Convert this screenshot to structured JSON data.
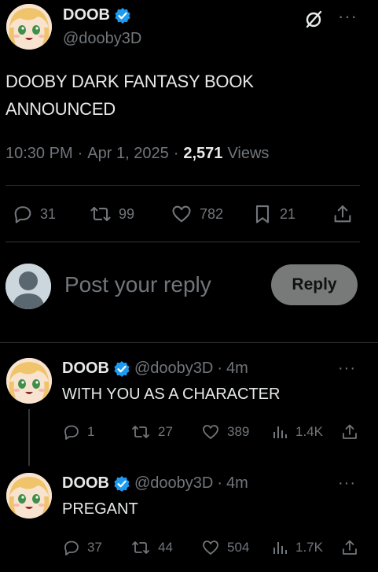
{
  "main_tweet": {
    "author": {
      "name": "DOOB",
      "handle": "@dooby3D",
      "verified": true
    },
    "text_line1": "DOOBY DARK FANTASY BOOK",
    "text_line2": "ANNOUNCED",
    "time": "10:30 PM",
    "sep1": "·",
    "date": "Apr 1, 2025",
    "sep2": "·",
    "views_count": "2,571",
    "views_label": "Views",
    "actions": {
      "replies": "31",
      "reposts": "99",
      "likes": "782",
      "bookmarks": "21"
    },
    "more": "···"
  },
  "reply_composer": {
    "placeholder": "Post your reply",
    "button_label": "Reply"
  },
  "replies": [
    {
      "name": "DOOB",
      "handle": "@dooby3D",
      "sep": "·",
      "time": "4m",
      "text": "WITH YOU AS A CHARACTER",
      "replies": "1",
      "reposts": "27",
      "likes": "389",
      "views": "1.4K",
      "more": "···"
    },
    {
      "name": "DOOB",
      "handle": "@dooby3D",
      "sep": "·",
      "time": "4m",
      "text": "PREGANT",
      "replies": "37",
      "reposts": "44",
      "likes": "504",
      "views": "1.7K",
      "more": "···"
    }
  ],
  "colors": {
    "background": "#000000",
    "text": "#e7e9ea",
    "muted": "#71767b",
    "divider": "#2f3336",
    "verified": "#1d9bf0",
    "reply_button": "#787a7a"
  },
  "icons": [
    "verified-badge-icon",
    "grok-icon",
    "more-icon",
    "reply-icon",
    "repost-icon",
    "like-icon",
    "bookmark-icon",
    "share-icon",
    "views-icon",
    "default-avatar-icon"
  ]
}
